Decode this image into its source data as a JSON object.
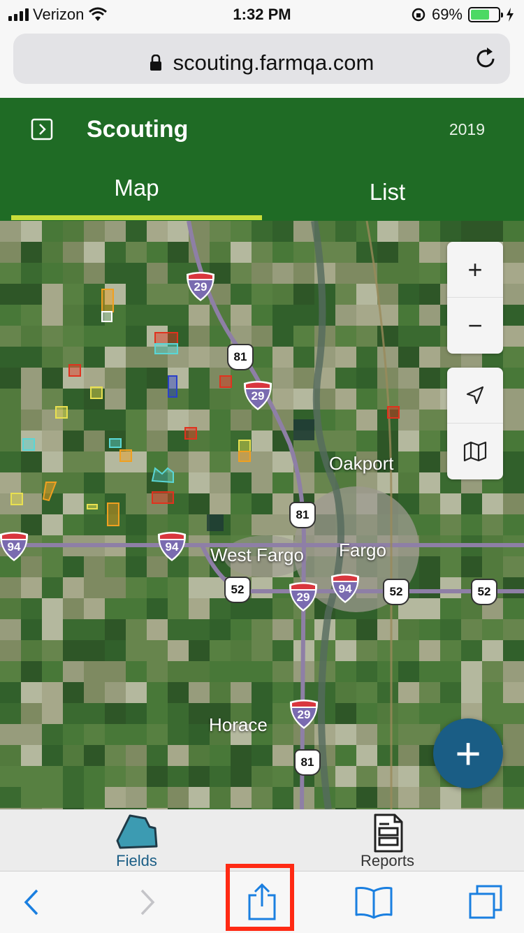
{
  "status": {
    "carrier": "Verizon",
    "time": "1:32 PM",
    "battery_text": "69%",
    "battery_level": 0.69
  },
  "browser": {
    "url": "scouting.farmqa.com"
  },
  "header": {
    "title": "Scouting",
    "year": "2019",
    "tabs": [
      {
        "label": "Map",
        "active": true
      },
      {
        "label": "List",
        "active": false
      }
    ]
  },
  "map": {
    "places": [
      "Oakport",
      "West Fargo",
      "Fargo",
      "Horace"
    ],
    "interstate_shields": [
      "29",
      "29",
      "94",
      "94",
      "29",
      "94",
      "29"
    ],
    "us_shields": [
      "81",
      "81",
      "52",
      "52",
      "52",
      "81"
    ],
    "controls": {
      "zoom_in": "+",
      "zoom_out": "−"
    },
    "fab_label": "+"
  },
  "app_tabs": [
    {
      "label": "Fields",
      "icon": "fields-icon",
      "active": true
    },
    {
      "label": "Reports",
      "icon": "reports-icon",
      "active": false
    }
  ],
  "colors": {
    "header_green": "#1f6b25",
    "tab_underline": "#c9dd3a",
    "active_tab_text": "#1a5d85",
    "fab": "#1a5d85",
    "highlight": "#ff2a14"
  }
}
